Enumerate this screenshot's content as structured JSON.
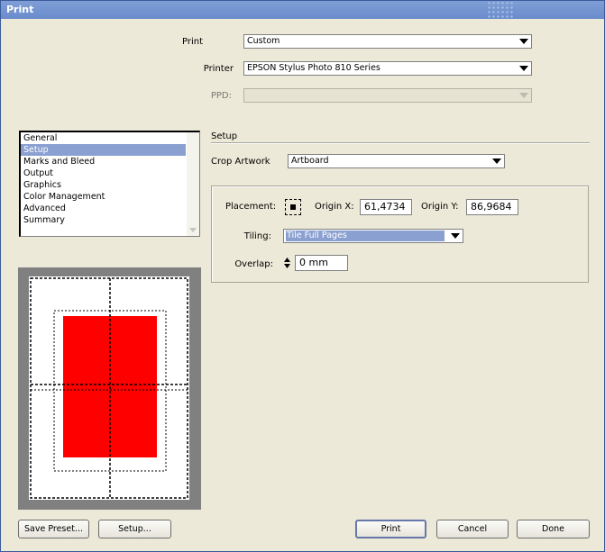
{
  "window": {
    "title": "Print"
  },
  "top": {
    "print_label": "Print",
    "print_value": "Custom",
    "printer_label": "Printer",
    "printer_value": "EPSON Stylus Photo 810 Series",
    "ppd_label": "PPD:",
    "ppd_value": ""
  },
  "sidebar": {
    "items": [
      {
        "label": "General"
      },
      {
        "label": "Setup"
      },
      {
        "label": "Marks and Bleed"
      },
      {
        "label": "Output"
      },
      {
        "label": "Graphics"
      },
      {
        "label": "Color Management"
      },
      {
        "label": "Advanced"
      },
      {
        "label": "Summary"
      }
    ],
    "selected": "Setup"
  },
  "setup": {
    "title": "Setup",
    "crop_label": "Crop Artwork",
    "crop_value": "Artboard",
    "placement_label": "Placement:",
    "origin_x_label": "Origin X:",
    "origin_x_value": "61,4734",
    "origin_y_label": "Origin Y:",
    "origin_y_value": "86,9684",
    "tiling_label": "Tiling:",
    "tiling_value": "Tile Full Pages",
    "overlap_label": "Overlap:",
    "overlap_value": "0 mm"
  },
  "buttons": {
    "save_preset": "Save Preset...",
    "setup": "Setup...",
    "print": "Print",
    "cancel": "Cancel",
    "done": "Done"
  },
  "colors": {
    "artwork": "#ff0000",
    "selection": "#8aa0d0",
    "titlebar": "#7393d0"
  }
}
